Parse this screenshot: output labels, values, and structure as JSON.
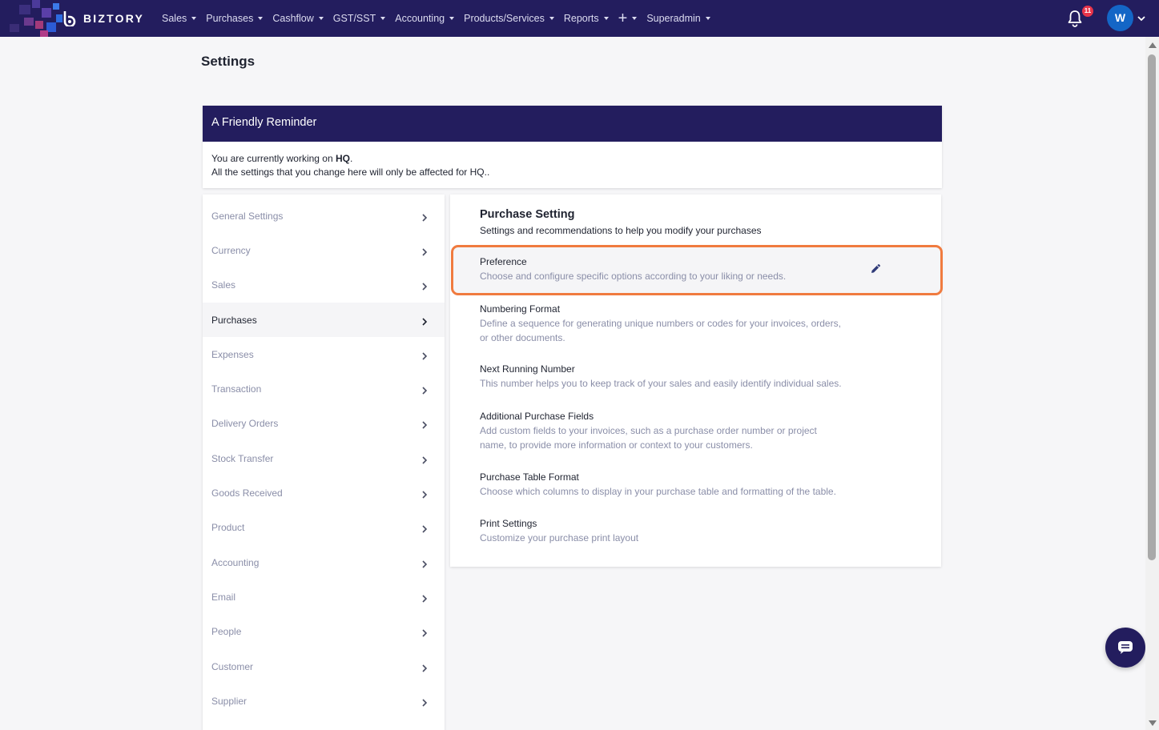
{
  "brand": {
    "name": "BIZTORY"
  },
  "nav": [
    {
      "label": "Sales"
    },
    {
      "label": "Purchases"
    },
    {
      "label": "Cashflow"
    },
    {
      "label": "GST/SST"
    },
    {
      "label": "Accounting"
    },
    {
      "label": "Products/Services"
    },
    {
      "label": "Reports"
    },
    {
      "label": "+"
    },
    {
      "label": "Superadmin"
    }
  ],
  "notifications": {
    "count": "11",
    "icon": "bell-icon"
  },
  "user": {
    "initial": "W"
  },
  "page": {
    "title": "Settings"
  },
  "reminder": {
    "title": "A Friendly Reminder",
    "line1_prefix": "You are currently working on ",
    "branch": "HQ",
    "line1_suffix": ".",
    "line2": "All the settings that you change here will only be affected for HQ.."
  },
  "sidebar": {
    "items": [
      {
        "label": "General Settings"
      },
      {
        "label": "Currency"
      },
      {
        "label": "Sales"
      },
      {
        "label": "Purchases"
      },
      {
        "label": "Expenses"
      },
      {
        "label": "Transaction"
      },
      {
        "label": "Delivery Orders"
      },
      {
        "label": "Stock Transfer"
      },
      {
        "label": "Goods Received"
      },
      {
        "label": "Product"
      },
      {
        "label": "Accounting"
      },
      {
        "label": "Email"
      },
      {
        "label": "People"
      },
      {
        "label": "Customer"
      },
      {
        "label": "Supplier"
      }
    ],
    "active": "Purchases"
  },
  "card": {
    "title": "Purchase Setting",
    "subtitle": "Settings and recommendations to help you modify your purchases",
    "options": [
      {
        "title": "Preference",
        "desc": "Choose and configure specific options according to your liking or needs."
      },
      {
        "title": "Numbering Format",
        "desc": "Define a sequence for generating unique numbers or codes for your invoices, orders, or other documents."
      },
      {
        "title": "Next Running Number",
        "desc": "This number helps you to keep track of your sales and easily identify individual sales."
      },
      {
        "title": "Additional Purchase Fields",
        "desc": "Add custom fields to your invoices, such as a purchase order number or project name, to provide more information or context to your customers."
      },
      {
        "title": "Purchase Table Format",
        "desc": "Choose which columns to display in your purchase table and formatting of the table."
      },
      {
        "title": "Print Settings",
        "desc": "Customize your purchase print layout"
      }
    ]
  },
  "colors": {
    "navbar": "#231d5e",
    "highlight_border": "#f07b3f",
    "muted_text": "#8a8ea8",
    "badge": "#e8344a",
    "avatar": "#1466c6"
  }
}
